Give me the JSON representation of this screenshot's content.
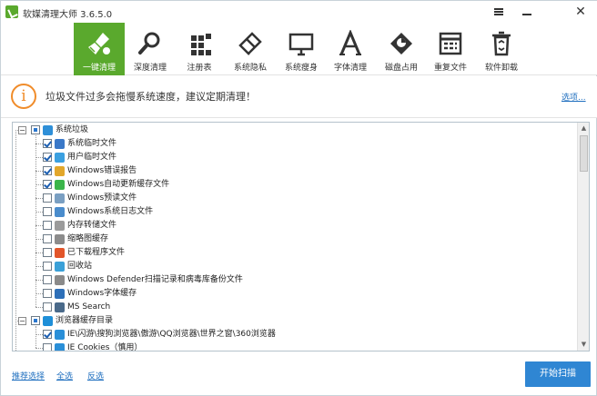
{
  "window": {
    "title": "软媒清理大师 3.6.5.0",
    "controls": [
      "menu-icon",
      "minimize-icon",
      "close-icon"
    ],
    "close_glyph": "✕"
  },
  "toolbar": {
    "items": [
      {
        "label": "一键清理",
        "icon": "broom-icon",
        "active": true
      },
      {
        "label": "深度清理",
        "icon": "magnifier-icon",
        "active": false
      },
      {
        "label": "注册表",
        "icon": "registry-blocks-icon",
        "active": false
      },
      {
        "label": "系统隐私",
        "icon": "eraser-icon",
        "active": false
      },
      {
        "label": "系统瘦身",
        "icon": "monitor-icon",
        "active": false
      },
      {
        "label": "字体清理",
        "icon": "font-a-icon",
        "active": false
      },
      {
        "label": "磁盘占用",
        "icon": "disk-pie-icon",
        "active": false
      },
      {
        "label": "重复文件",
        "icon": "grid-file-icon",
        "active": false
      },
      {
        "label": "软件卸载",
        "icon": "recycle-bin-icon",
        "active": false
      }
    ]
  },
  "notice": {
    "icon_glyph": "i",
    "text": "垃圾文件过多会拖慢系统速度，建议定期清理！",
    "options_link": "选项..."
  },
  "tree": {
    "groups": [
      {
        "label": "系统垃圾",
        "expander": "−",
        "state": "partial",
        "icon_color": "#2e8fd8",
        "items": [
          {
            "label": "系统临时文件",
            "checked": true,
            "icon_color": "#3a78c8"
          },
          {
            "label": "用户临时文件",
            "checked": true,
            "icon_color": "#3ba0e0"
          },
          {
            "label": "Windows错误报告",
            "checked": true,
            "icon_color": "#e2a72b"
          },
          {
            "label": "Windows自动更新缓存文件",
            "checked": true,
            "icon_color": "#3ab54a"
          },
          {
            "label": "Windows预读文件",
            "checked": false,
            "icon_color": "#7a9fc2"
          },
          {
            "label": "Windows系统日志文件",
            "checked": false,
            "icon_color": "#4a8ccc"
          },
          {
            "label": "内存转储文件",
            "checked": false,
            "icon_color": "#9b9b9b"
          },
          {
            "label": "缩略图缓存",
            "checked": false,
            "icon_color": "#8c8c8c"
          },
          {
            "label": "已下载程序文件",
            "checked": false,
            "icon_color": "#e2552a"
          },
          {
            "label": "回收站",
            "checked": false,
            "icon_color": "#3aa0d8"
          },
          {
            "label": "Windows Defender扫描记录和病毒库备份文件",
            "checked": false,
            "icon_color": "#8a8a8a"
          },
          {
            "label": "Windows字体缓存",
            "checked": false,
            "icon_color": "#2d6fb8"
          },
          {
            "label": "MS Search",
            "checked": false,
            "icon_color": "#4a6a8a"
          }
        ]
      },
      {
        "label": "浏览器缓存目录",
        "expander": "−",
        "state": "partial",
        "icon_color": "#1e8fd8",
        "items": [
          {
            "label": "IE\\闪游\\搜狗浏览器\\傲游\\QQ浏览器\\世界之窗\\360浏览器",
            "checked": true,
            "icon_color": "#2a8fd8"
          },
          {
            "label": "IE Cookies（慎用）",
            "checked": false,
            "icon_color": "#2a8fd8"
          }
        ]
      }
    ],
    "scroll_up_glyph": "▲",
    "scroll_down_glyph": "▼"
  },
  "footer": {
    "recommend_link": "推荐选择",
    "select_all_link": "全选",
    "invert_link": "反选",
    "scan_button": "开始扫描"
  }
}
